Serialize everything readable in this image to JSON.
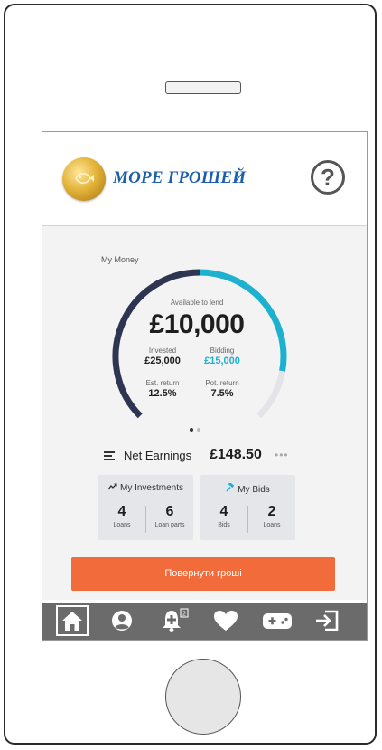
{
  "app": {
    "logo_text": "МОРЕ ГРОШЕЙ",
    "help_label": "?"
  },
  "money": {
    "title": "My Money",
    "available_label": "Available to lend",
    "available_amount": "£10,000",
    "invested_label": "Invested",
    "invested_value": "£25,000",
    "bidding_label": "Bidding",
    "bidding_value": "£15,000",
    "est_return_label": "Est. return",
    "est_return_value": "12.5%",
    "pot_return_label": "Pot. return",
    "pot_return_value": "7.5%",
    "ring_dark_fraction": 0.5,
    "ring_teal_fraction": 0.2,
    "pager": {
      "count": 2,
      "active": 1
    }
  },
  "net_earnings": {
    "label": "Net Earnings",
    "value": "£148.50",
    "more": "•••"
  },
  "investments": {
    "title": "My Investments",
    "icon": "trend-up-icon",
    "col1_value": "4",
    "col1_label": "Loans",
    "col2_value": "6",
    "col2_label": "Loan parts"
  },
  "bids": {
    "title": "My Bids",
    "icon": "gavel-icon",
    "col1_value": "4",
    "col1_label": "Bids",
    "col2_value": "2",
    "col2_label": "Loans"
  },
  "cta": {
    "label": "Повернути гроші"
  },
  "tabbar": {
    "items": [
      {
        "icon": "home-icon",
        "active": true
      },
      {
        "icon": "profile-icon",
        "active": false
      },
      {
        "icon": "notifications-icon",
        "active": false,
        "badge": "2"
      },
      {
        "icon": "heart-icon",
        "active": false
      },
      {
        "icon": "gamepad-icon",
        "active": false
      },
      {
        "icon": "logout-icon",
        "active": false
      }
    ]
  },
  "colors": {
    "accent": "#f26b3a",
    "teal": "#1bb1cf",
    "ring_dark": "#2e3550",
    "ring_track": "#e4e4e8",
    "tabbar": "#6b6b6b",
    "logo_blue": "#1b5fae"
  }
}
